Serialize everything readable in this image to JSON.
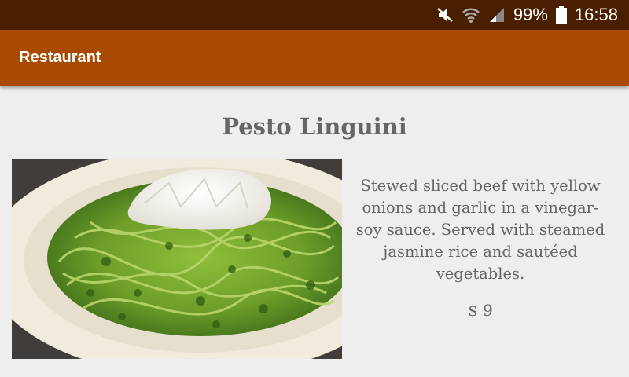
{
  "status_bar": {
    "battery_text": "99%",
    "time": "16:58",
    "icons": [
      "mute-icon",
      "wifi-icon",
      "signal-icon",
      "battery-icon"
    ]
  },
  "app_bar": {
    "title": "Restaurant",
    "color": "#a84b00"
  },
  "dish": {
    "name": "Pesto Linguini",
    "image": "pesto-linguini-photo",
    "description": "Stewed sliced beef with yellow onions and garlic in a vinegar-soy sauce. Served with steamed jasmine rice and sautéed vegetables.",
    "price": "$ 9"
  }
}
